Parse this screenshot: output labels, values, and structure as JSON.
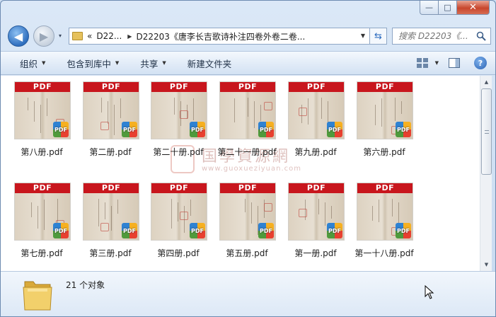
{
  "window": {
    "minimize": "—",
    "maximize": "□",
    "close": "✕"
  },
  "nav": {
    "back_icon": "◀",
    "forward_icon": "▶",
    "dropdown_icon": "▾"
  },
  "address": {
    "overflow": "«",
    "crumb1": "D22...",
    "crumb2": "D22203《唐李长吉歌诗补注四卷外卷二卷...",
    "refresh_icon": "⇆"
  },
  "search": {
    "placeholder": "搜索 D22203《..."
  },
  "toolbar": {
    "organize": "组织",
    "include_library": "包含到库中",
    "share": "共享",
    "new_folder": "新建文件夹"
  },
  "pdf_label": "PDF",
  "files": [
    {
      "name": "第八册.pdf"
    },
    {
      "name": "第二册.pdf"
    },
    {
      "name": "第二十册.pdf"
    },
    {
      "name": "第二十一册.pdf"
    },
    {
      "name": "第九册.pdf"
    },
    {
      "name": "第六册.pdf"
    },
    {
      "name": "第七册.pdf"
    },
    {
      "name": "第三册.pdf"
    },
    {
      "name": "第四册.pdf"
    },
    {
      "name": "第五册.pdf"
    },
    {
      "name": "第一册.pdf"
    },
    {
      "name": "第一十八册.pdf"
    }
  ],
  "watermark": {
    "text": "国學資源網",
    "url": "www.guoxueziyuan.com"
  },
  "status": {
    "count": "21 个对象"
  }
}
